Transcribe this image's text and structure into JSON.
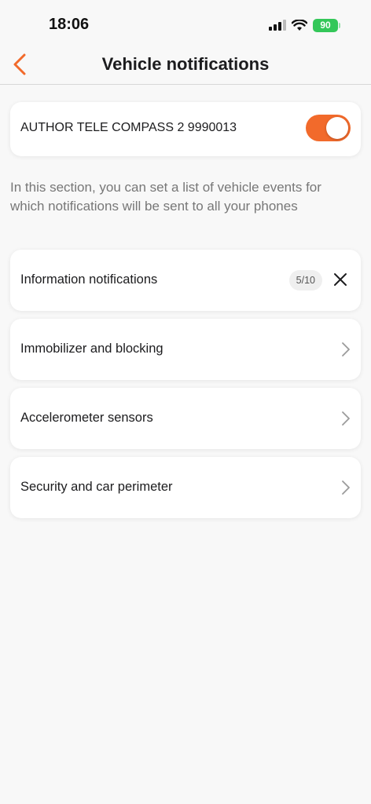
{
  "status_bar": {
    "time": "18:06",
    "battery": "90"
  },
  "nav": {
    "title": "Vehicle notifications"
  },
  "device": {
    "name": "AUTHOR TELE COMPASS 2 9990013",
    "notifications_enabled": true
  },
  "description": "In this section, you can set a list of vehicle events for which notifications will be sent to all your phones",
  "menu": [
    {
      "label": "Information notifications",
      "badge": "5/10"
    },
    {
      "label": "Immobilizer and blocking"
    },
    {
      "label": "Accelerometer sensors"
    },
    {
      "label": "Security and car perimeter"
    }
  ],
  "colors": {
    "accent": "#f26a2b",
    "battery": "#34c759",
    "background": "#f8f8f8"
  },
  "icons": [
    "back-chevron-icon",
    "signal-icon",
    "wifi-icon",
    "battery-icon",
    "close-icon",
    "chevron-right-icon"
  ]
}
